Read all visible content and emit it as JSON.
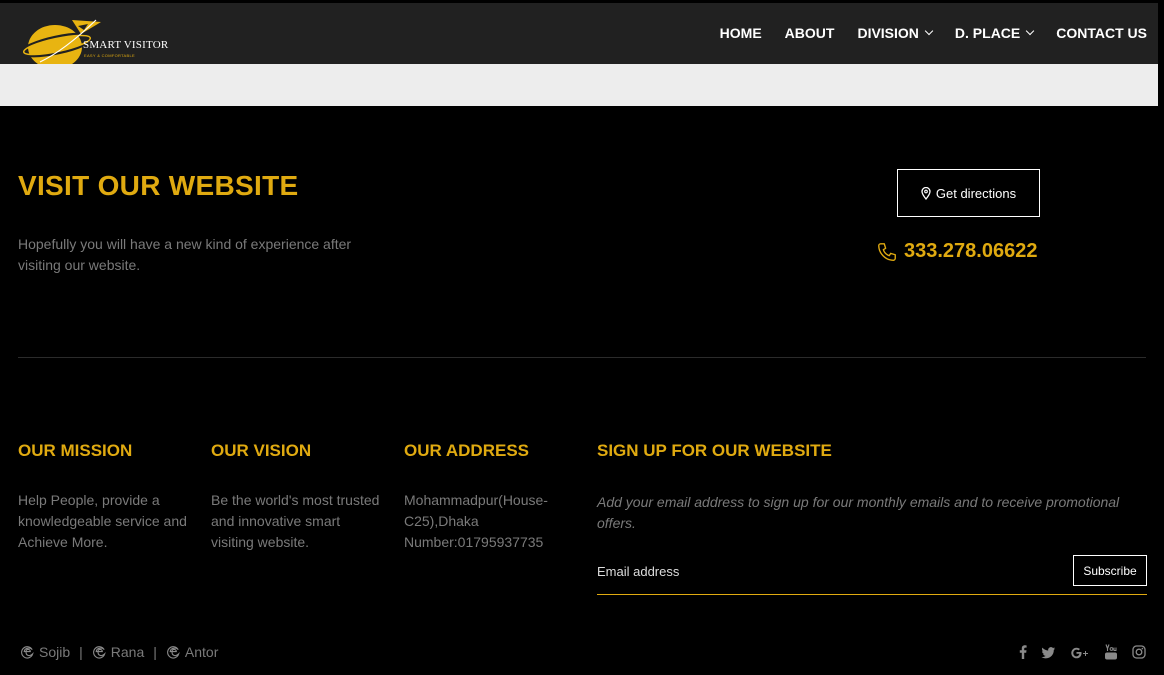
{
  "header": {
    "brand": "SMART VISITOR",
    "tagline": "EASY & COMFORTABLE",
    "nav": [
      {
        "label": "HOME"
      },
      {
        "label": "ABOUT"
      },
      {
        "label": "DIVISION"
      },
      {
        "label": "D. PLACE"
      },
      {
        "label": "CONTACT US"
      }
    ]
  },
  "hero": {
    "title": "VISIT OUR WEBSITE",
    "text": "Hopefully you will have a new kind of experience after visiting our website.",
    "directions_label": "Get directions",
    "phone": "333.278.06622"
  },
  "columns": {
    "mission": {
      "title": "OUR MISSION",
      "text": "Help People, provide a knowledgeable service and Achieve More."
    },
    "vision": {
      "title": "OUR VISION",
      "text": "Be the world's most trusted and innovative smart visiting website."
    },
    "address": {
      "title": "OUR ADDRESS",
      "line1": "Mohammadpur(House-",
      "line2": "C25),Dhaka",
      "line3": "Number:01795937735"
    },
    "signup": {
      "title": "SIGN UP FOR OUR WEBSITE",
      "text": "Add your email address to sign up for our monthly emails and to receive promotional offers.",
      "placeholder": "Email address",
      "button": "Subscribe"
    }
  },
  "footer": {
    "credits": [
      "Sojib",
      "Rana",
      "Antor"
    ],
    "separator": "|",
    "social": [
      "facebook-icon",
      "twitter-icon",
      "google-plus-icon",
      "youtube-icon",
      "instagram-icon"
    ]
  },
  "colors": {
    "accent": "#e0aa10",
    "background": "#000000",
    "navbar": "#212121",
    "band": "#ededed"
  }
}
